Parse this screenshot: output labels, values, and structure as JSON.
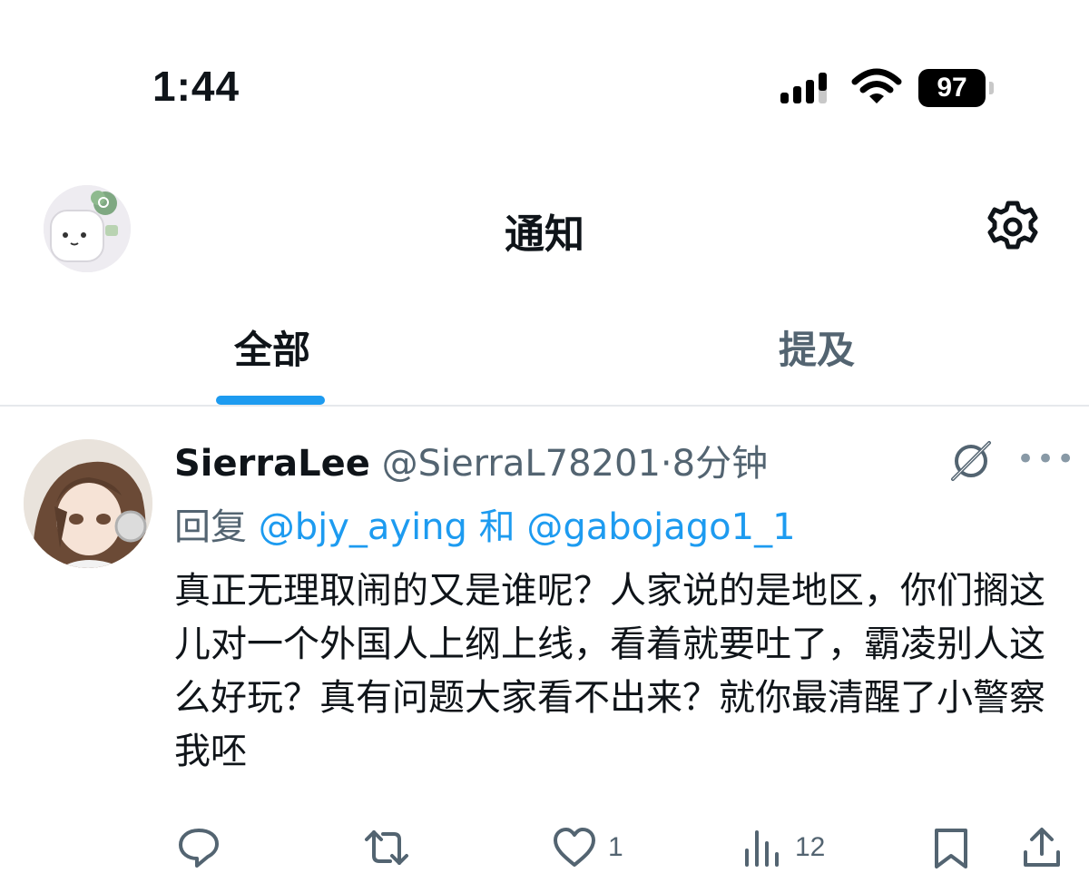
{
  "status_bar": {
    "time": "1:44",
    "battery": "97",
    "icons": [
      "signal-icon",
      "wifi-icon",
      "battery-icon"
    ]
  },
  "header": {
    "title": "通知",
    "settings_icon": "gear-icon"
  },
  "tabs": [
    {
      "label": "全部",
      "active": true
    },
    {
      "label": "提及",
      "active": false
    }
  ],
  "notification": {
    "display_name": "SierraLee",
    "handle": "@SierraL78201",
    "separator": "·",
    "time": "8分钟",
    "reply_prefix": "回复",
    "reply_to_1": "@bjy_aying",
    "reply_and": "和",
    "reply_to_2": "@gabojago1_1",
    "text": "真正无理取闹的又是谁呢？人家说的是地区，你们搁这儿对一个外国人上纲上线，看着就要吐了，霸凌别人这么好玩？真有问题大家看不出来？就你最清醒了小警察我呸",
    "actions": {
      "reply_count": "",
      "retweet_count": "",
      "like_count": "1",
      "views_count": "12"
    }
  },
  "colors": {
    "accent": "#1d9bf0",
    "secondary_text": "#536471",
    "primary_text": "#0f1419"
  }
}
